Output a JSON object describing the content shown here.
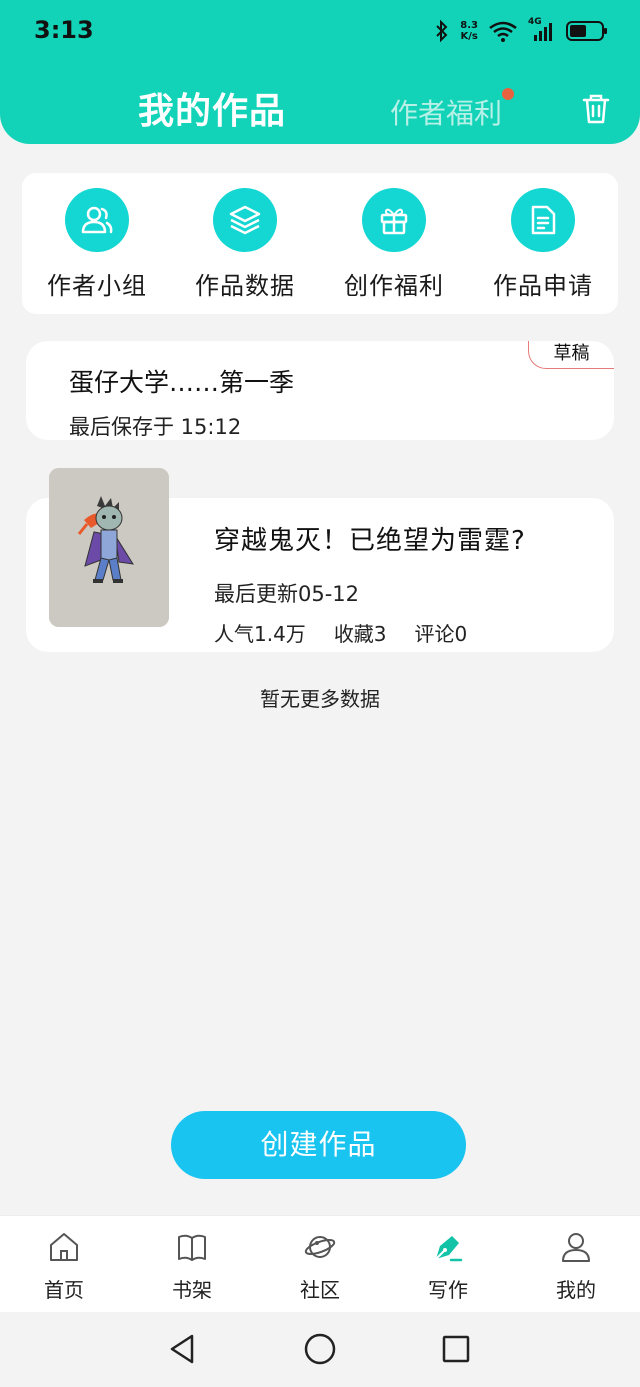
{
  "status": {
    "time": "3:13",
    "net_speed_value": "8.3",
    "net_speed_unit": "K/s",
    "signal_label": "4G"
  },
  "header": {
    "title": "我的作品",
    "welfare": "作者福利"
  },
  "quick_actions": [
    {
      "label": "作者小组",
      "icon": "people-icon"
    },
    {
      "label": "作品数据",
      "icon": "layers-icon"
    },
    {
      "label": "创作福利",
      "icon": "gift-icon"
    },
    {
      "label": "作品申请",
      "icon": "document-icon"
    }
  ],
  "draft": {
    "title": "蛋仔大学……第一季",
    "saved": "最后保存于 15:12",
    "badge": "草稿"
  },
  "work": {
    "title": "穿越鬼灭！已绝望为雷霆?",
    "updated": "最后更新05-12",
    "popularity": "人气1.4万",
    "favorites": "收藏3",
    "comments": "评论0"
  },
  "no_more": "暂无更多数据",
  "create_button": "创建作品",
  "tabs": [
    {
      "label": "首页",
      "icon": "home-icon",
      "active": false
    },
    {
      "label": "书架",
      "icon": "book-icon",
      "active": false
    },
    {
      "label": "社区",
      "icon": "planet-icon",
      "active": false
    },
    {
      "label": "写作",
      "icon": "pen-icon",
      "active": true
    },
    {
      "label": "我的",
      "icon": "user-icon",
      "active": false
    }
  ],
  "colors": {
    "header": "#12d3b8",
    "accent_cyan": "#14d6d2",
    "create_button": "#19c4f0",
    "welfare_dot": "#e9623f",
    "draft_badge_border": "#e77a7a"
  }
}
